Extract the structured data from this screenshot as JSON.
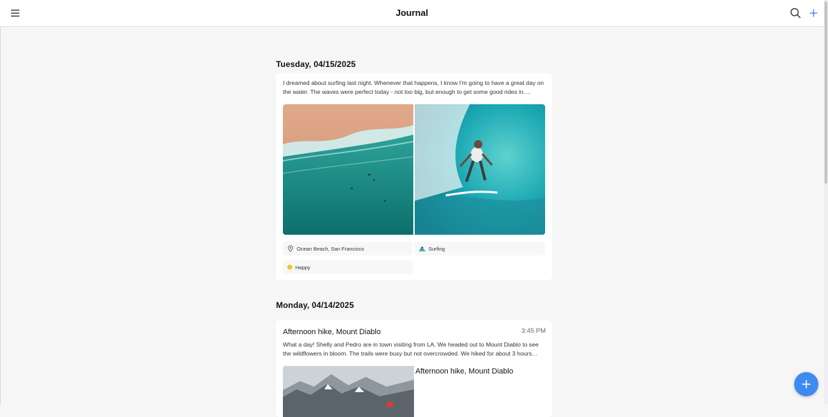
{
  "app": {
    "title": "Journal"
  },
  "header": {
    "menu_icon": "hamburger-menu-icon",
    "search_icon": "search-icon",
    "add_icon": "plus-icon"
  },
  "days": [
    {
      "date_label": "Tuesday, 04/15/2025",
      "entry": {
        "text": "I dreamed about surfing last night. Whenever that happens, I know I'm going to have a great day on the water. The waves were perfect today - not too big, but enough to get some good rides in.…",
        "photos": [
          "aerial-beach-photo",
          "surfer-barrel-photo"
        ],
        "location": "Ocean Beach, San Francisco",
        "activity": "Surfing",
        "mood": "Happy"
      }
    },
    {
      "date_label": "Monday, 04/14/2025",
      "entry": {
        "title": "Afternoon hike, Mount Diablo",
        "time": "3:45 PM",
        "text": "What a day! Shelly and Pedro are in town visiting from LA. We headed out to Mount Diablo to see the wildflowers in bloom. The trails were busy but not overcrowded. We hiked for about 3 hours…",
        "photo_caption": "Afternoon hike, Mount Diablo"
      }
    }
  ],
  "fab": {
    "icon": "plus-icon"
  },
  "colors": {
    "accent": "#3d8af0",
    "mood_dot": "#f5c518",
    "background": "#f6f6f6"
  }
}
